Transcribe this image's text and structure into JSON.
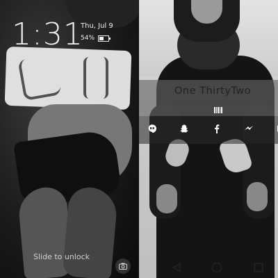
{
  "lock_screen": {
    "time": "1:31",
    "date": "Thu, Jul 9",
    "battery_percent": "54%",
    "battery_level": 0.54,
    "unlock_hint": "Slide to unlock"
  },
  "widget": {
    "app_title": "One ThirtyTwo",
    "shortcuts": [
      {
        "icon": "hangouts-icon"
      },
      {
        "icon": "snapchat-icon"
      },
      {
        "icon": "facebook-icon"
      },
      {
        "icon": "messenger-icon"
      }
    ]
  },
  "nav": {
    "icons": [
      "back-icon",
      "home-icon",
      "recents-icon"
    ]
  },
  "icons": {
    "camera": "camera-icon",
    "barcode": "barcode-icon"
  },
  "colors": {
    "text_light": "#f2f2f2",
    "widget_text": "#222222"
  }
}
